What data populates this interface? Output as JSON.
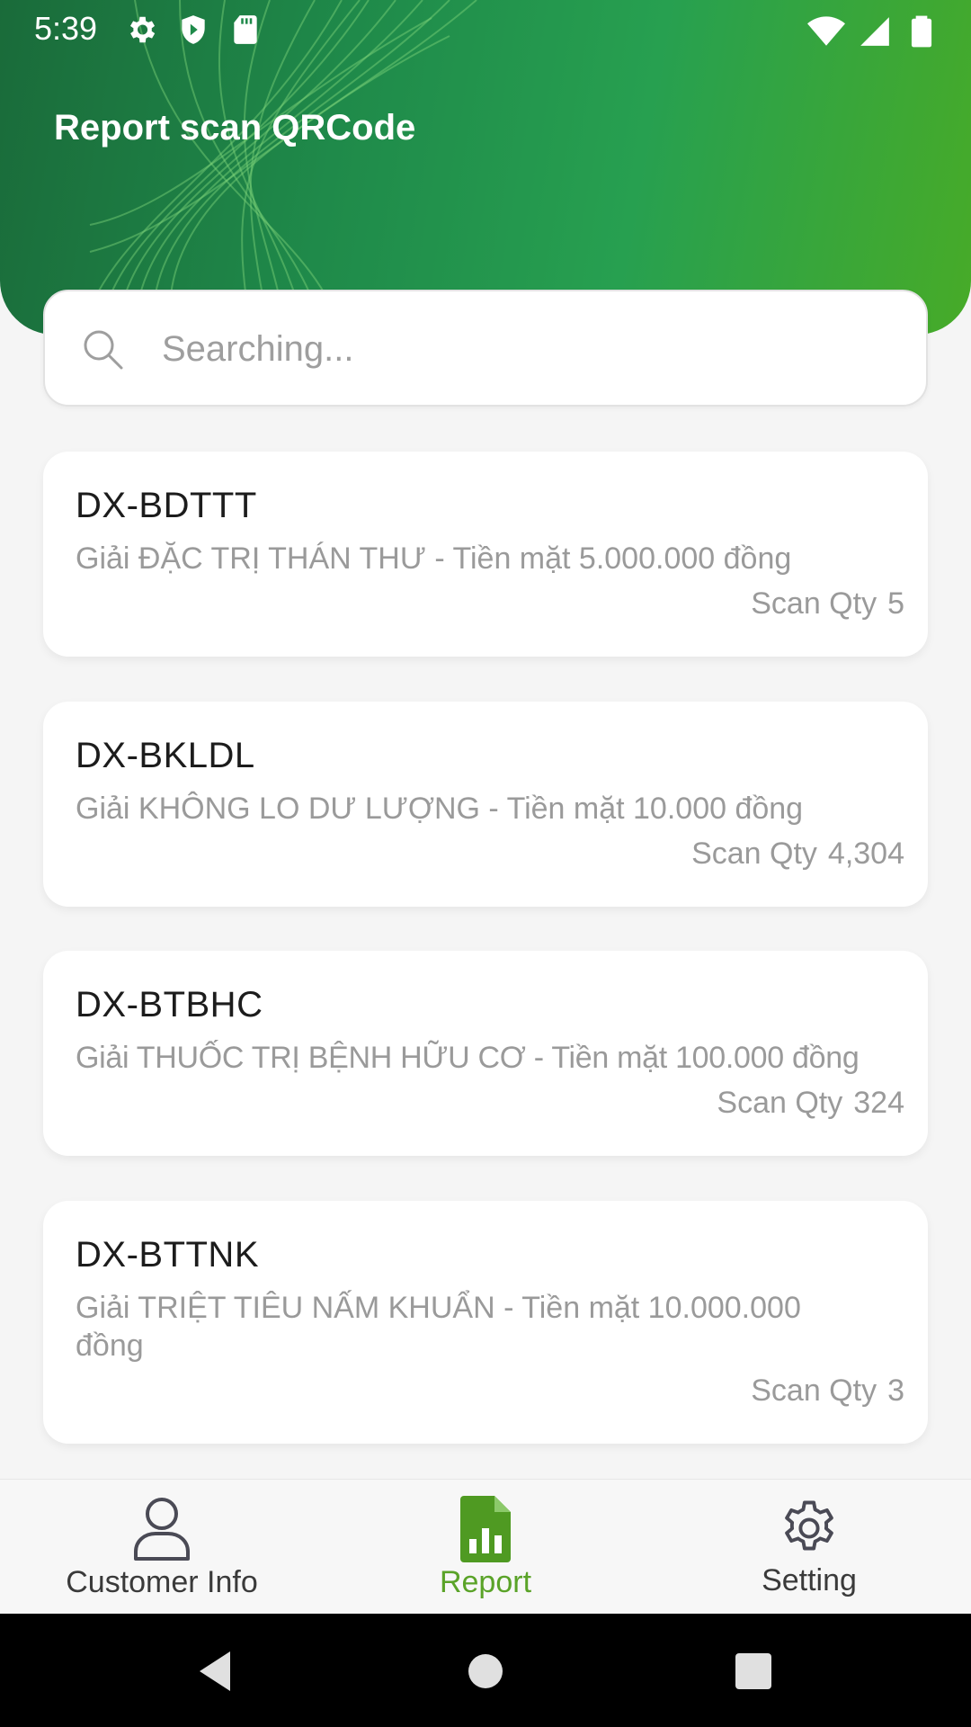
{
  "status_bar": {
    "time": "5:39",
    "left_icons": [
      "gear-icon",
      "shield-icon",
      "sd-card-icon"
    ],
    "right_icons": [
      "wifi-icon",
      "signal-icon",
      "battery-icon"
    ]
  },
  "header": {
    "title": "Report scan QRCode",
    "gradient_colors": [
      "#1a6b3a",
      "#47ab28"
    ]
  },
  "search": {
    "placeholder": "Searching...",
    "value": "",
    "icon": "search-icon"
  },
  "items": [
    {
      "code": "DX-BDTTT",
      "description": "Giải ĐẶC TRỊ THÁN THƯ - Tiền mặt 5.000.000 đồng",
      "qty_label": "Scan Qty",
      "qty": "5"
    },
    {
      "code": "DX-BKLDL",
      "description": "Giải KHÔNG LO DƯ LƯỢNG - Tiền mặt 10.000 đồng",
      "qty_label": "Scan Qty",
      "qty": "4,304"
    },
    {
      "code": "DX-BTBHC",
      "description": "Giải THUỐC TRỊ BỆNH HỮU CƠ - Tiền mặt 100.000 đồng",
      "qty_label": "Scan Qty",
      "qty": "324"
    },
    {
      "code": "DX-BTTNK",
      "description": "Giải TRIỆT TIÊU NẤM KHUẨN - Tiền mặt 10.000.000 đồng",
      "qty_label": "Scan Qty",
      "qty": "3"
    }
  ],
  "bottom_nav": {
    "items": [
      {
        "label": "Customer Info",
        "icon": "person-icon",
        "active": false
      },
      {
        "label": "Report",
        "icon": "report-icon",
        "active": true
      },
      {
        "label": "Setting",
        "icon": "gear-icon",
        "active": false
      }
    ],
    "active_color": "#5aa328",
    "inactive_color": "#3a3a3a"
  },
  "system_nav": {
    "buttons": [
      "back-icon",
      "home-icon",
      "recents-icon"
    ]
  }
}
